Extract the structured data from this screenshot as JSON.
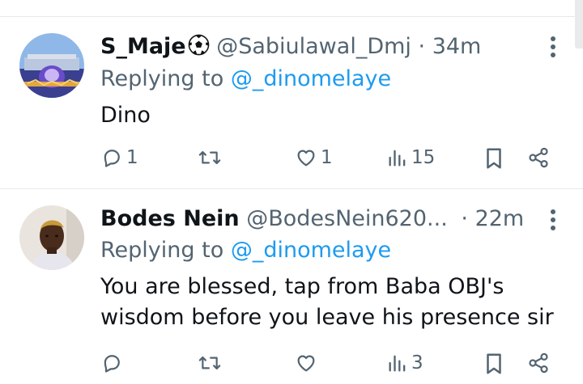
{
  "tweets": [
    {
      "name": "S_Maje",
      "handle": "@Sabiulawal_Dmj",
      "separator": "·",
      "time": "34m",
      "replying_prefix": "Replying to",
      "replying_to": "@_dinomelaye",
      "text": "Dino",
      "reply_count": "1",
      "retweet_count": "",
      "like_count": "1",
      "view_count": "15",
      "name_emoji_icon": "soccer-ball-icon"
    },
    {
      "name": "Bodes Nein",
      "handle": "@BodesNein620...",
      "separator": "·",
      "time": "22m",
      "replying_prefix": "Replying to",
      "replying_to": "@_dinomelaye",
      "text": "You are blessed, tap from Baba OBJ's wisdom before you leave his presence sir",
      "reply_count": "",
      "retweet_count": "",
      "like_count": "",
      "view_count": "3"
    }
  ],
  "colors": {
    "text": "#0f1419",
    "secondary": "#536471",
    "link": "#1d9bf0",
    "divider": "#e6e9ec"
  }
}
